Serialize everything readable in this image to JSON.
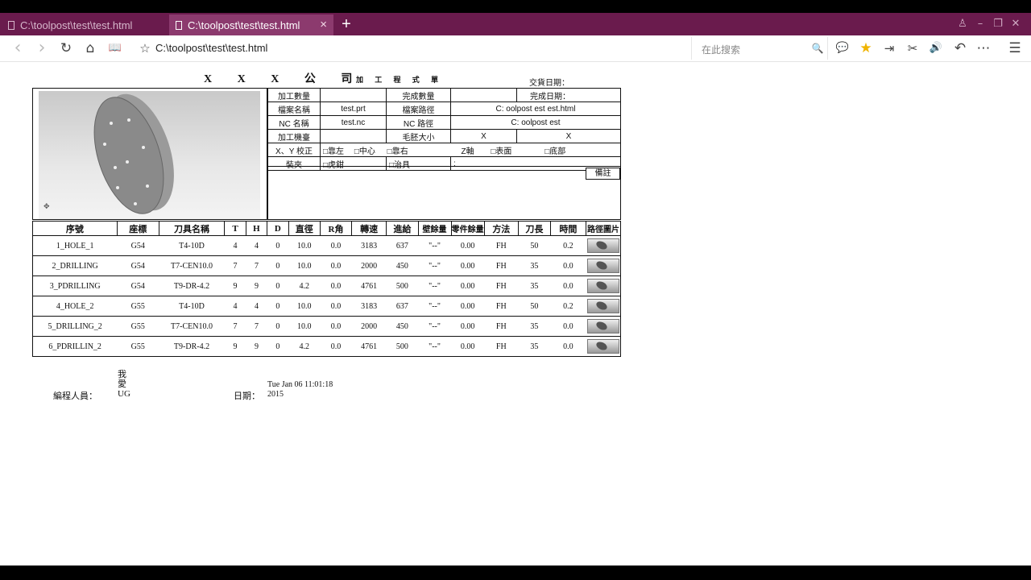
{
  "browser": {
    "tabs": [
      {
        "label": "C:\\toolpost\\test\\test.html",
        "active": false
      },
      {
        "label": "C:\\toolpost\\test\\test.html",
        "active": true
      }
    ],
    "new_tab": "+",
    "close_tab": "×",
    "url": "C:\\toolpost\\test\\test.html",
    "search_placeholder": "在此搜索",
    "window_buttons": {
      "user": "♙",
      "minimize": "–",
      "restore": "❐",
      "close": "✕"
    },
    "nav_icons": {
      "back": "‹",
      "forward": "›",
      "reload": "↻",
      "home": "⌂",
      "reader": "📖",
      "star": "☆",
      "search": "🔍",
      "wechat": "💬",
      "favorite": "★",
      "exit": "⇥",
      "cut": "✂",
      "volume": "🔊",
      "undo": "↶",
      "more": "⋯",
      "menu": "☰"
    },
    "accent": "#6a1b4d"
  },
  "doc": {
    "company": "X X X 公 司",
    "sheet_title": "加 工 程 式 單",
    "delivery_label": "交貨日期：",
    "info": {
      "qty_label": "加工數量",
      "qty_value": "",
      "done_qty_label": "完成數量",
      "done_qty_value": "",
      "done_date_label": "完成日期：",
      "file_label": "檔案名稱",
      "file_value": "test.prt",
      "file_path_label": "檔案路徑",
      "file_path_value": "C: oolpost est est.html",
      "nc_label": "NC 名稱",
      "nc_value": "test.nc",
      "nc_path_label": "NC 路徑",
      "nc_path_value": "C: oolpost est",
      "machine_label": "加工機臺",
      "machine_value": "",
      "blank_label": "毛胚大小",
      "blank_x1": "X",
      "blank_x2": "X",
      "xy_label": "X、Y 校正",
      "xy_opt1": "□靠左",
      "xy_opt2": "□中心",
      "xy_opt3": "□靠右",
      "z_label": "Z軸",
      "z_opt1": "□表面",
      "z_opt2": "□底部",
      "clamp_label": "裝夾",
      "clamp_opt1": "□虎鉗",
      "clamp_opt2": "□治具",
      "clamp_colon": ":"
    },
    "remark_label": "備註",
    "columns": [
      "序號",
      "座標",
      "刀具名稱",
      "T",
      "H",
      "D",
      "直徑",
      "R角",
      "轉速",
      "進給",
      "壁餘量",
      "零件餘量",
      "方法",
      "刀長",
      "時間",
      "路徑圖片"
    ],
    "rows": [
      [
        "1_HOLE_1",
        "G54",
        "T4-10D",
        "4",
        "4",
        "0",
        "10.0",
        "0.0",
        "3183",
        "637",
        "\"--\"",
        "0.00",
        "FH",
        "50",
        "0.2"
      ],
      [
        "2_DRILLING",
        "G54",
        "T7-CEN10.0",
        "7",
        "7",
        "0",
        "10.0",
        "0.0",
        "2000",
        "450",
        "\"--\"",
        "0.00",
        "FH",
        "35",
        "0.0"
      ],
      [
        "3_PDRILLING",
        "G54",
        "T9-DR-4.2",
        "9",
        "9",
        "0",
        "4.2",
        "0.0",
        "4761",
        "500",
        "\"--\"",
        "0.00",
        "FH",
        "35",
        "0.0"
      ],
      [
        "4_HOLE_2",
        "G55",
        "T4-10D",
        "4",
        "4",
        "0",
        "10.0",
        "0.0",
        "3183",
        "637",
        "\"--\"",
        "0.00",
        "FH",
        "50",
        "0.2"
      ],
      [
        "5_DRILLING_2",
        "G55",
        "T7-CEN10.0",
        "7",
        "7",
        "0",
        "10.0",
        "0.0",
        "2000",
        "450",
        "\"--\"",
        "0.00",
        "FH",
        "35",
        "0.0"
      ],
      [
        "6_PDRILLIN_2",
        "G55",
        "T9-DR-4.2",
        "9",
        "9",
        "0",
        "4.2",
        "0.0",
        "4761",
        "500",
        "\"--\"",
        "0.00",
        "FH",
        "35",
        "0.0"
      ]
    ],
    "footer": {
      "programmer_label": "編程人員：",
      "programmer_value": "我\n愛\nUG",
      "date_label": "日期：",
      "date_value": "Tue Jan 06 11:01:18\n2015"
    }
  }
}
